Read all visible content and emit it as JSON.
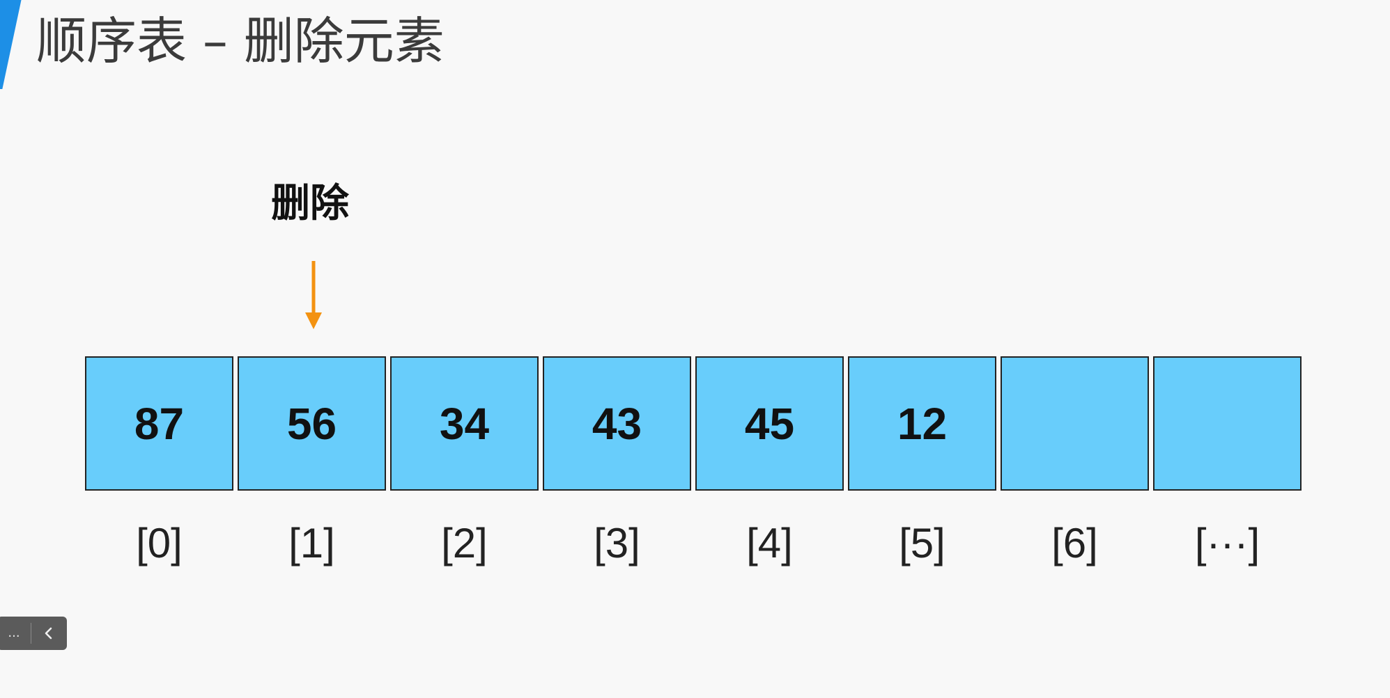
{
  "slide": {
    "title": "顺序表 – 删除元素",
    "accent_color": "#1d8fe6"
  },
  "operation": {
    "label": "删除",
    "target_index": 1,
    "arrow_color": "#f39211"
  },
  "array": {
    "cell_color": "#68cdfb",
    "cells": [
      {
        "index": "[0]",
        "value": "87"
      },
      {
        "index": "[1]",
        "value": "56"
      },
      {
        "index": "[2]",
        "value": "34"
      },
      {
        "index": "[3]",
        "value": "43"
      },
      {
        "index": "[4]",
        "value": "45"
      },
      {
        "index": "[5]",
        "value": "12"
      },
      {
        "index": "[6]",
        "value": ""
      },
      {
        "index": "[···]",
        "value": ""
      }
    ]
  },
  "player_controls": {
    "more_label": "...",
    "back_icon": "chevron-left-icon"
  }
}
